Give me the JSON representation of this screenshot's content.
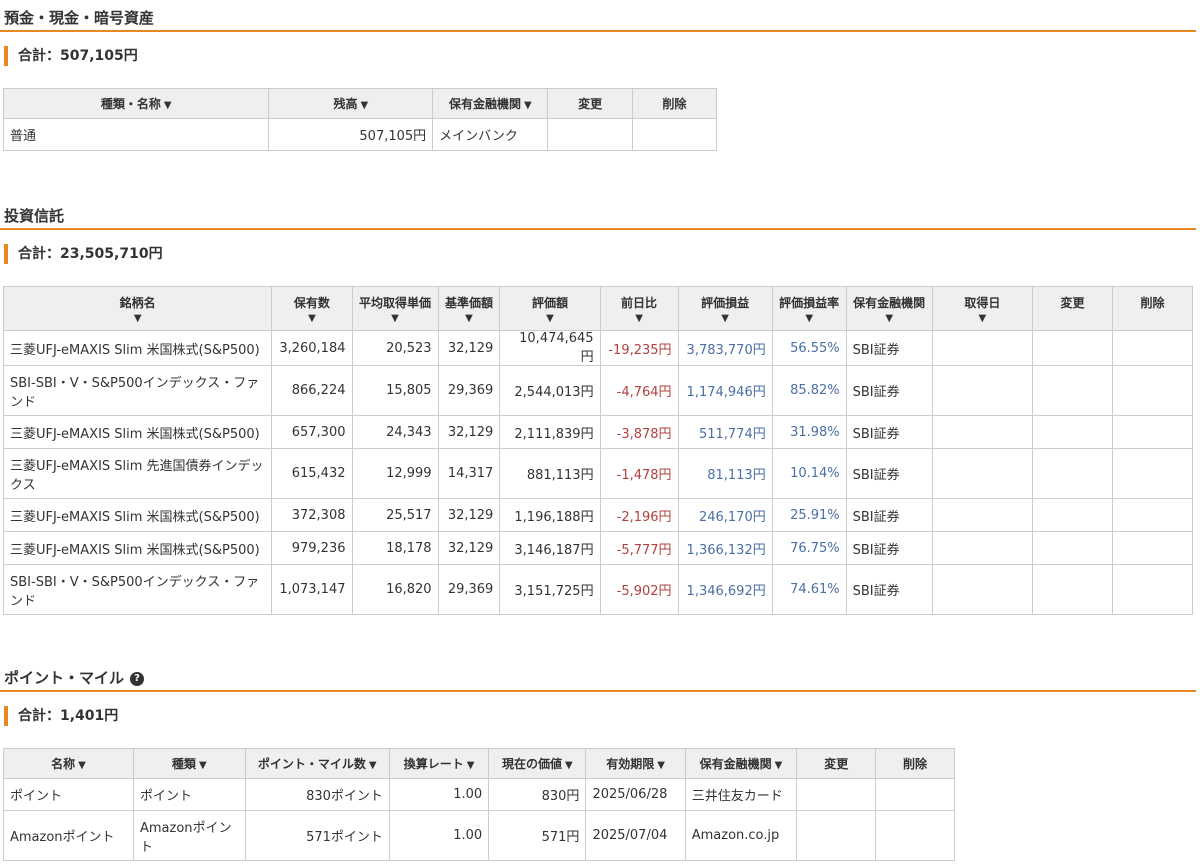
{
  "deposits": {
    "title": "預金・現金・暗号資産",
    "total": "合計：507,105円",
    "headers": {
      "name": "種類・名称",
      "balance": "残高",
      "institution": "保有金融機関",
      "edit": "変更",
      "delete": "削除"
    },
    "rows": [
      {
        "name": "普通",
        "balance": "507,105円",
        "institution": "メインバンク"
      }
    ]
  },
  "funds": {
    "title": "投資信託",
    "total": "合計：23,505,710円",
    "headers": {
      "name": "銘柄名",
      "qty": "保有数",
      "avg_price": "平均取得単価",
      "base_price": "基準価額",
      "value": "評価額",
      "day_change": "前日比",
      "gain": "評価損益",
      "gain_rate": "評価損益率",
      "institution": "保有金融機関",
      "acquired": "取得日",
      "edit": "変更",
      "delete": "削除"
    },
    "rows": [
      {
        "name": "三菱UFJ-eMAXIS Slim 米国株式(S&P500)",
        "qty": "3,260,184",
        "avg": "20,523",
        "base": "32,129",
        "value": "10,474,645円",
        "day": "-19,235円",
        "gain": "3,783,770円",
        "rate": "56.55%",
        "inst": "SBI証券"
      },
      {
        "name": "SBI-SBI・V・S&P500インデックス・ファンド",
        "qty": "866,224",
        "avg": "15,805",
        "base": "29,369",
        "value": "2,544,013円",
        "day": "-4,764円",
        "gain": "1,174,946円",
        "rate": "85.82%",
        "inst": "SBI証券"
      },
      {
        "name": "三菱UFJ-eMAXIS Slim 米国株式(S&P500)",
        "qty": "657,300",
        "avg": "24,343",
        "base": "32,129",
        "value": "2,111,839円",
        "day": "-3,878円",
        "gain": "511,774円",
        "rate": "31.98%",
        "inst": "SBI証券"
      },
      {
        "name": "三菱UFJ-eMAXIS Slim 先進国債券インデックス",
        "qty": "615,432",
        "avg": "12,999",
        "base": "14,317",
        "value": "881,113円",
        "day": "-1,478円",
        "gain": "81,113円",
        "rate": "10.14%",
        "inst": "SBI証券"
      },
      {
        "name": "三菱UFJ-eMAXIS Slim 米国株式(S&P500)",
        "qty": "372,308",
        "avg": "25,517",
        "base": "32,129",
        "value": "1,196,188円",
        "day": "-2,196円",
        "gain": "246,170円",
        "rate": "25.91%",
        "inst": "SBI証券"
      },
      {
        "name": "三菱UFJ-eMAXIS Slim 米国株式(S&P500)",
        "qty": "979,236",
        "avg": "18,178",
        "base": "32,129",
        "value": "3,146,187円",
        "day": "-5,777円",
        "gain": "1,366,132円",
        "rate": "76.75%",
        "inst": "SBI証券"
      },
      {
        "name": "SBI-SBI・V・S&P500インデックス・ファンド",
        "qty": "1,073,147",
        "avg": "16,820",
        "base": "29,369",
        "value": "3,151,725円",
        "day": "-5,902円",
        "gain": "1,346,692円",
        "rate": "74.61%",
        "inst": "SBI証券"
      }
    ]
  },
  "points": {
    "title": "ポイント・マイル",
    "total": "合計：1,401円",
    "headers": {
      "name": "名称",
      "type": "種類",
      "count": "ポイント・マイル数",
      "rate": "換算レート",
      "value": "現在の価値",
      "expiry": "有効期限",
      "institution": "保有金融機関",
      "edit": "変更",
      "delete": "削除"
    },
    "rows": [
      {
        "name": "ポイント",
        "type": "ポイント",
        "count": "830ポイント",
        "rate": "1.00",
        "value": "830円",
        "expiry": "2025/06/28",
        "inst": "三井住友カード"
      },
      {
        "name": "Amazonポイント",
        "type": "Amazonポイント",
        "count": "571ポイント",
        "rate": "1.00",
        "value": "571円",
        "expiry": "2025/07/04",
        "inst": "Amazon.co.jp"
      }
    ]
  },
  "colors": {
    "accent": "#e8891e",
    "negative": "#b0413e",
    "positive": "#4a6fa5",
    "header_bg": "#efefef"
  }
}
